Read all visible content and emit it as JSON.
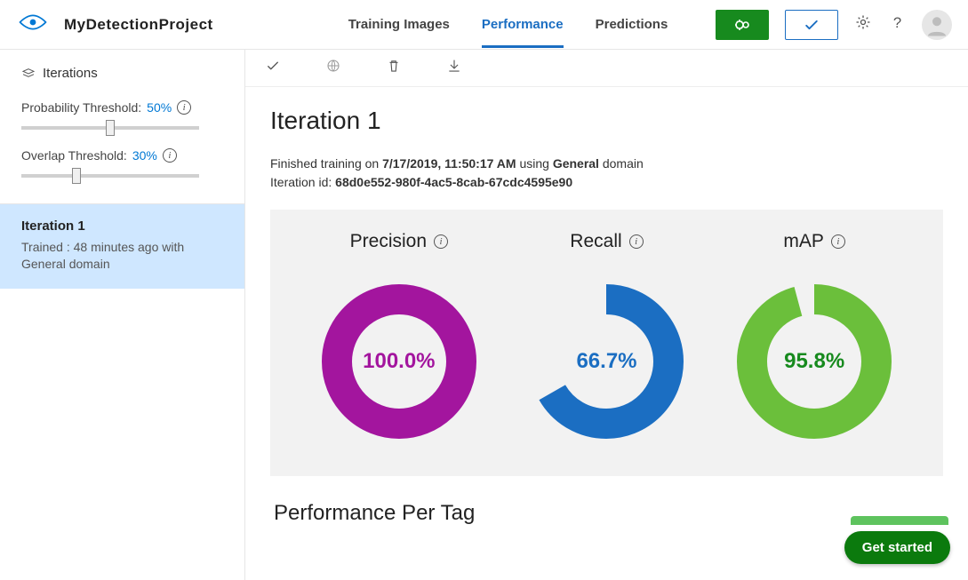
{
  "header": {
    "project_name": "MyDetectionProject",
    "tabs": [
      "Training Images",
      "Performance",
      "Predictions"
    ],
    "active_tab_index": 1
  },
  "sidebar": {
    "heading": "Iterations",
    "prob_threshold": {
      "label": "Probability Threshold:",
      "value_pct": 50,
      "value_text": "50%"
    },
    "overlap_threshold": {
      "label": "Overlap Threshold:",
      "value_pct": 30,
      "value_text": "30%"
    },
    "iteration": {
      "name": "Iteration 1",
      "meta_line1": "Trained : 48 minutes ago with",
      "meta_line2": "General domain"
    }
  },
  "main": {
    "title": "Iteration 1",
    "status": {
      "prefix": "Finished training on ",
      "datetime": "7/17/2019, 11:50:17 AM",
      "mid": " using ",
      "domain": "General",
      "mid2": " domain",
      "line2_prefix": "Iteration id: ",
      "iteration_id": "68d0e552-980f-4ac5-8cab-67cdc4595e90"
    },
    "per_tag_heading": "Performance Per Tag",
    "get_started": "Get started"
  },
  "chart_data": [
    {
      "type": "pie",
      "title": "Precision",
      "value_pct": 100.0,
      "value_text": "100.0%",
      "color": "#a3159e",
      "text_color": "#a3159e"
    },
    {
      "type": "pie",
      "title": "Recall",
      "value_pct": 66.7,
      "value_text": "66.7%",
      "color": "#1b6ec2",
      "text_color": "#1b6ec2"
    },
    {
      "type": "pie",
      "title": "mAP",
      "value_pct": 95.8,
      "value_text": "95.8%",
      "color": "#6bbf3b",
      "text_color": "#178a1e"
    }
  ]
}
